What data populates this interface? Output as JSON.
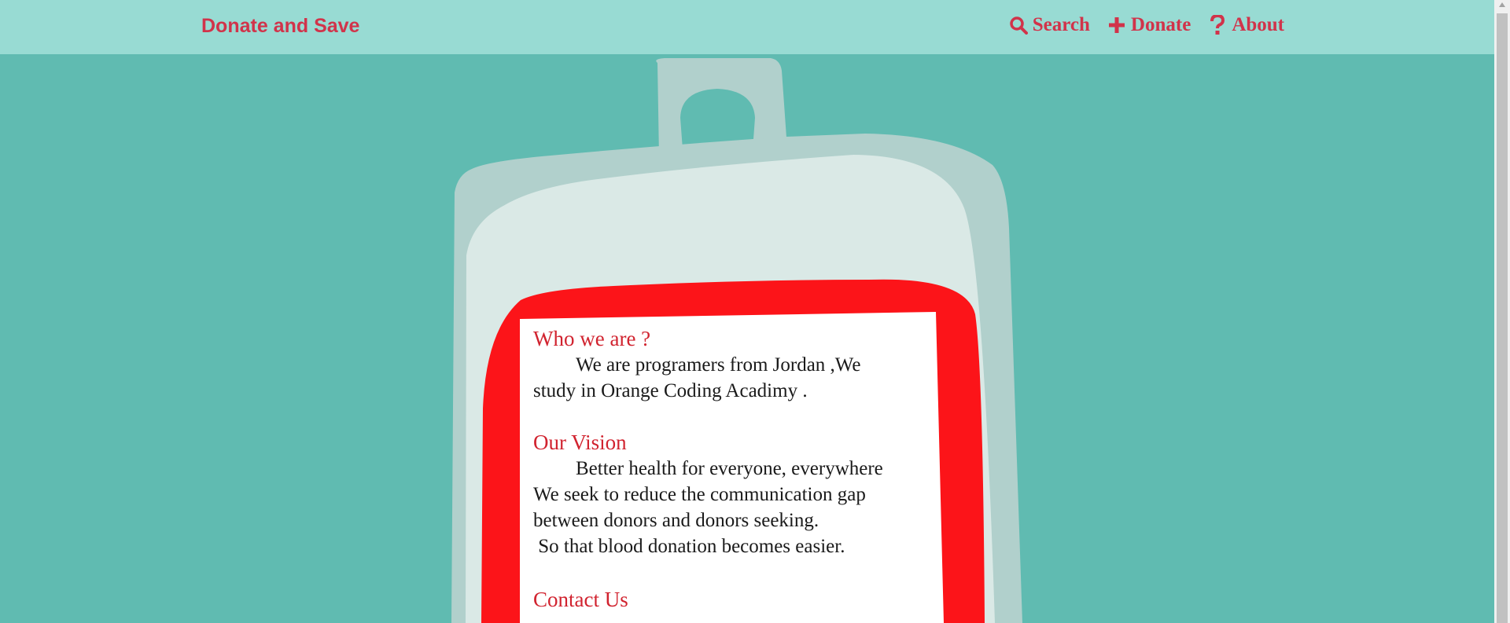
{
  "nav": {
    "brand": "Donate and Save",
    "links": [
      {
        "label": "Search",
        "icon": "search-icon"
      },
      {
        "label": "Donate",
        "icon": "plus-icon"
      },
      {
        "label": "About",
        "icon": "question-icon"
      }
    ]
  },
  "about": {
    "who_title": "Who we are ?",
    "who_text_1": "We are programers from Jordan ,We",
    "who_text_2": "study in Orange Coding Acadimy .",
    "vision_title": "Our Vision",
    "vision_line_1": "Better health for everyone, everywhere",
    "vision_line_2": "We seek to reduce the communication gap",
    "vision_line_3": "between donors and donors seeking.",
    "vision_line_4": " So that blood donation becomes easier.",
    "contact_title": "Contact Us"
  },
  "colors": {
    "background": "#60bbb1",
    "navbar": "#98dbd3",
    "accent": "#d1334a",
    "blood": "#fc1419",
    "bag_outer": "#b1d0cc",
    "bag_inner": "#dae9e6"
  }
}
